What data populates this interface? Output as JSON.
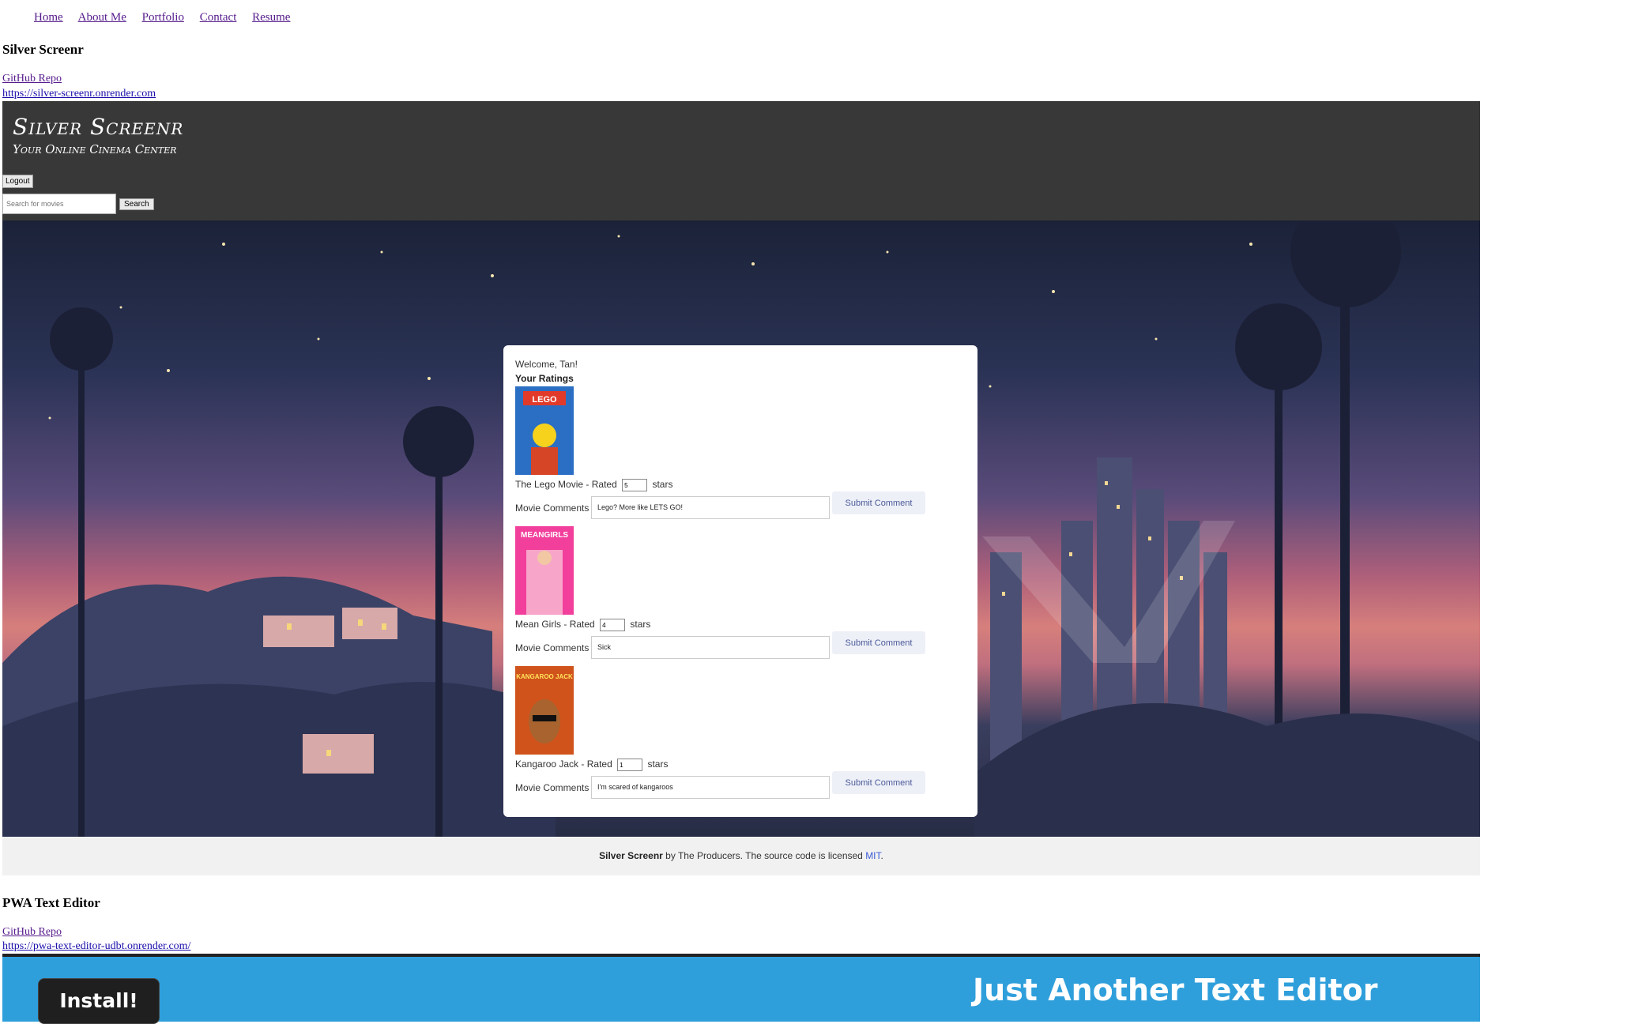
{
  "nav": [
    "Home",
    "About Me",
    "Portfolio",
    "Contact",
    "Resume"
  ],
  "projects": [
    {
      "title": "Silver Screenr",
      "repo_label": "GitHub Repo",
      "url": "https://silver-screenr.onrender.com"
    },
    {
      "title": "PWA Text Editor",
      "repo_label": "GitHub Repo",
      "url": "https://pwa-text-editor-udbt.onrender.com/"
    }
  ],
  "silver_screenr": {
    "logo_title": "Silver Screenr",
    "logo_subtitle": "Your Online Cinema Center",
    "logout_label": "Logout",
    "search_placeholder": "Search for movies",
    "search_button": "Search",
    "welcome": "Welcome, Tan!",
    "ratings_heading": "Your Ratings",
    "rated_label": "- Rated",
    "stars_label": "stars",
    "comments_label": "Movie Comments",
    "submit_label": "Submit Comment",
    "movies": [
      {
        "title": "The Lego Movie",
        "rating": "5",
        "comment": "Lego? More like LETS GO!",
        "poster_text": "LEGO",
        "poster_color": "#2b6fc4"
      },
      {
        "title": "Mean Girls",
        "rating": "4",
        "comment": "Sick",
        "poster_text": "MEANGIRLS",
        "poster_color": "#f23f9c"
      },
      {
        "title": "Kangaroo Jack",
        "rating": "1",
        "comment": "I'm scared of kangaroos",
        "poster_text": "KANGAROO JACK",
        "poster_color": "#d0531c"
      }
    ],
    "footer": {
      "brand": "Silver Screenr",
      "text": " by The Producers. The source code is licensed ",
      "license": "MIT",
      "end": "."
    }
  },
  "pwa": {
    "install_label": "Install!",
    "title": "Just Another Text Editor"
  }
}
